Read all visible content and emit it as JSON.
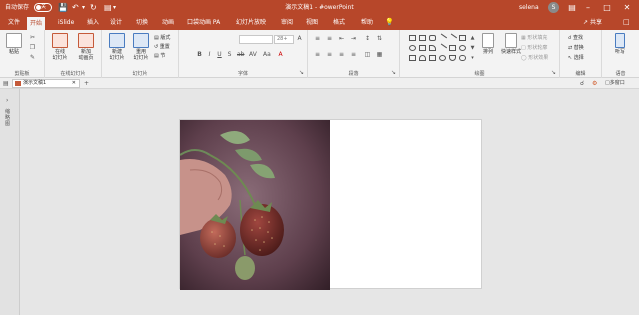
{
  "titlebar": {
    "autosave_label": "自动保存",
    "autosave_state": "关",
    "title": "演示文稿1 - #owerPoint",
    "user": "selena",
    "avatar_letter": "S",
    "icons": [
      "save-icon",
      "undo-icon",
      "redo-icon",
      "customize-icon",
      "ribbon-options-icon",
      "minimize-icon",
      "maximize-icon",
      "close-icon"
    ]
  },
  "tabs": [
    {
      "label": "文件"
    },
    {
      "label": "开始"
    },
    {
      "label": "iSlide"
    },
    {
      "label": "插入"
    },
    {
      "label": "设计"
    },
    {
      "label": "切换"
    },
    {
      "label": "动画"
    },
    {
      "label": "口袋动画 PA"
    },
    {
      "label": "幻灯片放映"
    },
    {
      "label": "审阅"
    },
    {
      "label": "视图"
    },
    {
      "label": "格式"
    },
    {
      "label": "帮助"
    }
  ],
  "share_label": "共享",
  "ribbon": {
    "clipboard": {
      "paste": "粘贴",
      "label": "剪贴板"
    },
    "online": {
      "btn": "在线\n幻灯片",
      "label": "在线幻灯片"
    },
    "slides": {
      "new_slide": "新建\n幻灯片",
      "reuse": "重用\n幻灯片",
      "layout": "版式",
      "reset": "重置",
      "section": "节",
      "label": "幻灯片",
      "new_anim": "新加\n动画页"
    },
    "font": {
      "size": "28+",
      "label": "字体"
    },
    "paragraph": {
      "label": "段落"
    },
    "drawing": {
      "arrange": "排列",
      "quick_styles": "快速样式",
      "fill": "形状填充",
      "outline": "形状轮廓",
      "effects": "形状效果",
      "label": "绘图"
    },
    "editing": {
      "find": "查找",
      "replace": "替换",
      "select": "选择",
      "label": "编辑"
    },
    "voice": {
      "dictate": "听写",
      "label": "语音"
    }
  },
  "quickrow": {
    "doc_tab": "演示文稿1",
    "multi_window": "多窗口"
  },
  "thumbpane": {
    "label": "缩略图"
  },
  "colors": {
    "accent": "#b7472a",
    "ribbon_bg": "#f3f3f3",
    "workspace_bg": "#e6e6e6"
  }
}
